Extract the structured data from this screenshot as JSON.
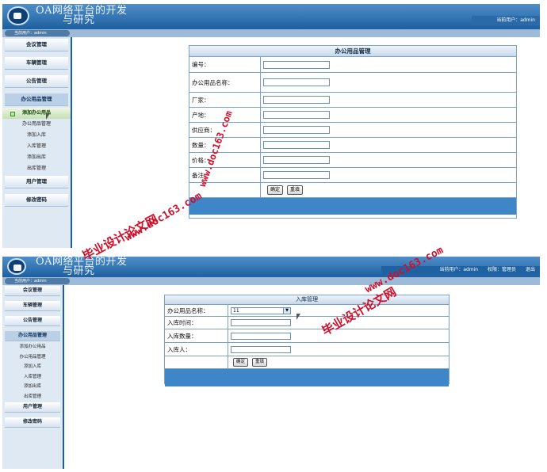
{
  "app": {
    "title_line1": "OA网络平台的开发",
    "title_line2": "与研究"
  },
  "panel1": {
    "header_right": "当前用户：admin",
    "current_user": "当前用户：admin",
    "menu": [
      {
        "label": "会议管理"
      },
      {
        "label": "车辆管理"
      },
      {
        "label": "公告管理"
      },
      {
        "label": "办公用品管理"
      }
    ],
    "submenu": [
      {
        "label": "添加办公用品"
      },
      {
        "label": "办公用品管理"
      },
      {
        "label": "添加入库"
      },
      {
        "label": "入库管理"
      },
      {
        "label": "添加出库"
      },
      {
        "label": "出库管理"
      }
    ],
    "menu_after": [
      {
        "label": "用户管理"
      },
      {
        "label": "修改密码"
      }
    ],
    "form": {
      "title": "办公用品管理",
      "fields": [
        {
          "label": "编号：",
          "value": ""
        },
        {
          "label": "办公用品名称：",
          "value": ""
        },
        {
          "label": "厂家：",
          "value": ""
        },
        {
          "label": "产地：",
          "value": ""
        },
        {
          "label": "供应商：",
          "value": ""
        },
        {
          "label": "数量：",
          "value": ""
        },
        {
          "label": "价格：",
          "value": ""
        },
        {
          "label": "备注：",
          "value": ""
        }
      ],
      "confirm": "确定",
      "reset": "重填"
    }
  },
  "panel2": {
    "header_right": [
      "当前用户：admin",
      "权限：管理员",
      "退出"
    ],
    "current_user": "当前用户：admin",
    "menu": [
      {
        "label": "会议管理"
      },
      {
        "label": "车辆管理"
      },
      {
        "label": "公告管理"
      },
      {
        "label": "办公用品管理"
      }
    ],
    "submenu": [
      {
        "label": "添加办公用品"
      },
      {
        "label": "办公用品管理"
      },
      {
        "label": "添加入库"
      },
      {
        "label": "入库管理"
      },
      {
        "label": "添加出库"
      },
      {
        "label": "出库管理"
      }
    ],
    "menu_after": [
      {
        "label": "用户管理"
      },
      {
        "label": "修改密码"
      }
    ],
    "form": {
      "title": "入库管理",
      "select_label": "办公用品名称：",
      "select_value": "11",
      "fields": [
        {
          "label": "入库时间：",
          "value": ""
        },
        {
          "label": "入库数量：",
          "value": ""
        },
        {
          "label": "入库人：",
          "value": ""
        }
      ],
      "confirm": "确定",
      "reset": "重填"
    }
  },
  "watermarks": {
    "cn": "毕业设计论文网",
    "url": "www.doc163.com"
  },
  "colors": {
    "header": "#1d5f9f",
    "accent": "#3f86c8",
    "watermark": "#d0102a"
  }
}
